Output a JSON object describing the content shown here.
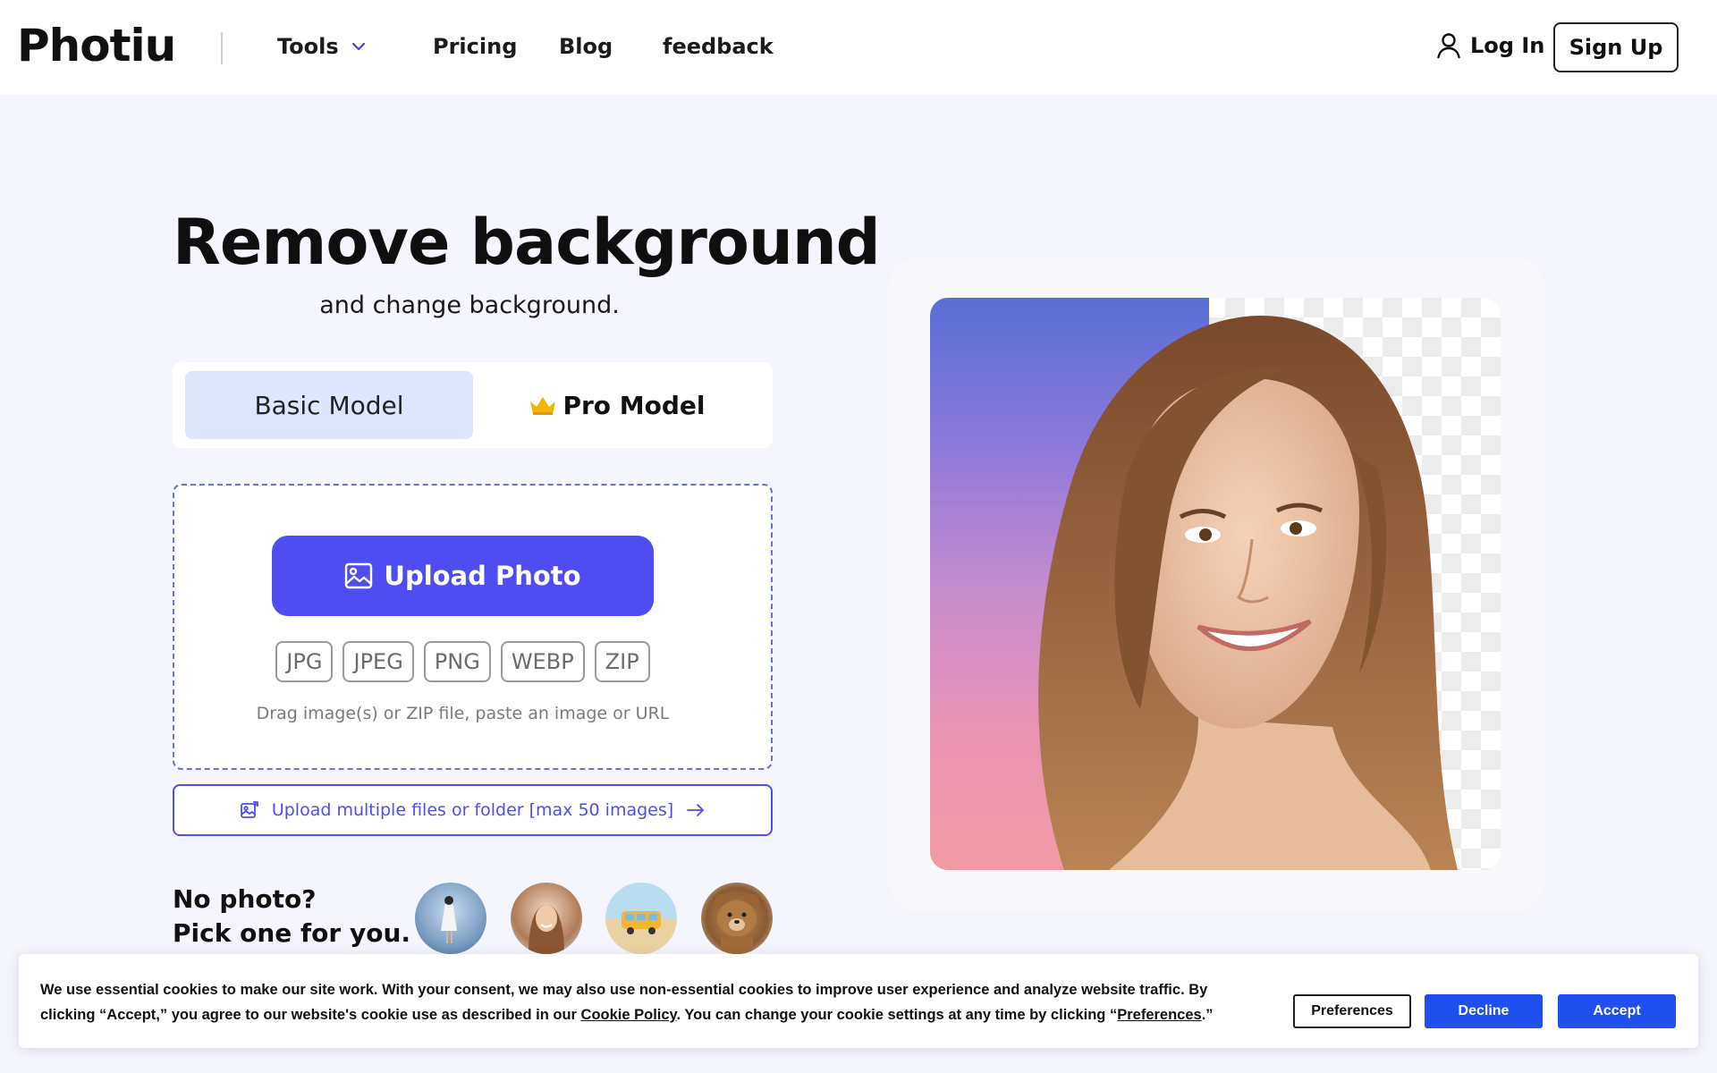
{
  "header": {
    "logo": "Photiu",
    "nav": {
      "tools": "Tools",
      "pricing": "Pricing",
      "blog": "Blog",
      "feedback": "feedback"
    },
    "login": "Log In",
    "signup": "Sign Up"
  },
  "hero": {
    "title": "Remove background",
    "subtitle": "and change background."
  },
  "models": {
    "basic": "Basic Model",
    "pro": "Pro Model"
  },
  "upload": {
    "button": "Upload Photo",
    "formats": [
      "JPG",
      "JPEG",
      "PNG",
      "WEBP",
      "ZIP"
    ],
    "hint": "Drag image(s) or ZIP file, paste an image or URL",
    "multi": "Upload multiple files or folder [max 50 images]"
  },
  "samples": {
    "line1": "No photo?",
    "line2": "Pick one for you."
  },
  "cookie": {
    "text_part1": "We use essential cookies to make our site work. With your consent, we may also use non-essential cookies to improve user experience and analyze website traffic. By clicking “Accept,” you agree to our website's cookie use as described in our ",
    "policy_link": "Cookie Policy",
    "text_part2": ". You can change your cookie settings at any time by clicking “",
    "preferences_link": "Preferences",
    "text_part3": ".”",
    "preferences": "Preferences",
    "decline": "Decline",
    "accept": "Accept"
  },
  "colors": {
    "accent": "#4f4df2",
    "cookie_button": "#1f50ee",
    "page_bg": "#f5f5fd",
    "basic_model_bg": "#dde6fb"
  }
}
